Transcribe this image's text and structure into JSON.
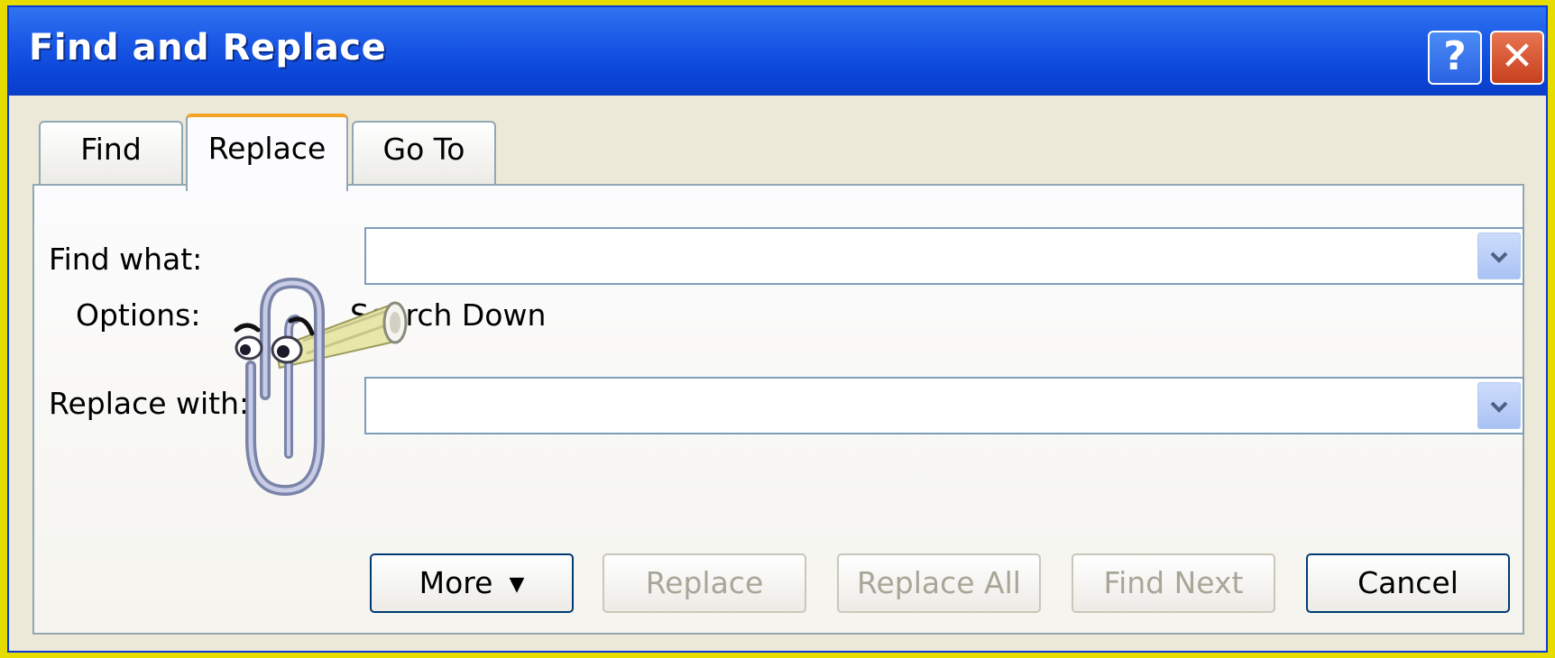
{
  "window": {
    "title": "Find and Replace",
    "help_label": "?",
    "close_label": "✕"
  },
  "tabs": [
    {
      "label": "Find",
      "selected": false
    },
    {
      "label": "Replace",
      "selected": true
    },
    {
      "label": "Go To",
      "selected": false
    }
  ],
  "form": {
    "find_label": "Find what:",
    "find_value": "",
    "options_label": "Options:",
    "options_value": "Search Down",
    "replace_label": "Replace with:",
    "replace_value": ""
  },
  "buttons": {
    "more": "More",
    "more_glyph": "▼",
    "replace": "Replace",
    "replace_all": "Replace All",
    "find_next": "Find Next",
    "cancel": "Cancel"
  },
  "icons": {
    "dropdown_arrow": "chevron-down-icon",
    "assistant": "clippy-assistant-icon"
  },
  "colors": {
    "titlebar": "#0b46d8",
    "tab_accent": "#f4a424",
    "background": "#ece9d8",
    "outer_frame": "#e6dc00"
  }
}
